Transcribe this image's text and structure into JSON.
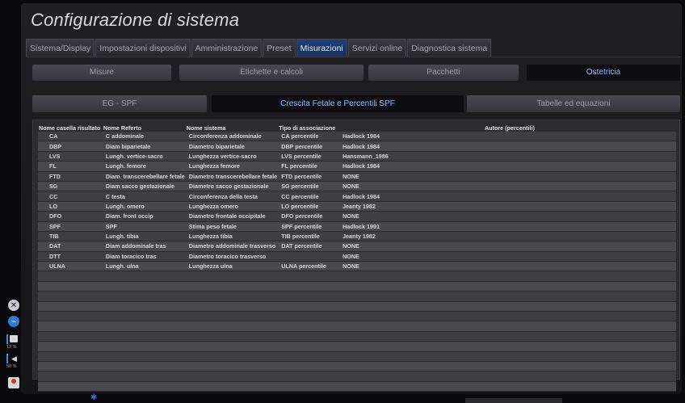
{
  "title": "Configurazione di sistema",
  "tabs": [
    {
      "label": "Sistema/Display",
      "active": false
    },
    {
      "label": "Impostazioni dispositivi",
      "active": false
    },
    {
      "label": "Amministrazione",
      "active": false
    },
    {
      "label": "Preset",
      "active": false
    },
    {
      "label": "Misurazioni",
      "active": true
    },
    {
      "label": "Servizi online",
      "active": false
    },
    {
      "label": "Diagnostica sistema",
      "active": false
    }
  ],
  "subtabs": [
    {
      "label": "Misure",
      "active": false
    },
    {
      "label": "Etichette e calcoli",
      "active": false
    },
    {
      "label": "Pacchetti",
      "active": false
    },
    {
      "label": "Ostetricia",
      "active": true
    }
  ],
  "subtabs2": [
    {
      "label": "EG - SPF",
      "active": false
    },
    {
      "label": "Crescita Fetale e Percentili SPF",
      "active": true
    },
    {
      "label": "Tabelle ed equazioni",
      "active": false
    }
  ],
  "table": {
    "headers": [
      "Nome casella risultato",
      "Nome Referto",
      "Nome sistema",
      "Tipo di associazione",
      "",
      "Autore (percentili)"
    ],
    "rows": [
      [
        "CA",
        "C addominale",
        "Circonferenza addominale",
        "CA percentile",
        "Hadlock 1984",
        ""
      ],
      [
        "DBP",
        "Diam biparietale",
        "Diametro biparietale",
        "DBP percentile",
        "Hadlock 1984",
        ""
      ],
      [
        "LVS",
        "Lungh. vertice-sacro",
        "Lunghezza vertice-sacro",
        "LVS percentile",
        "Hansmann_1986",
        ""
      ],
      [
        "FL",
        "Lungh. femore",
        "Lunghezza femore",
        "FL percentile",
        "Hadlock 1984",
        ""
      ],
      [
        "FTD",
        "Diam. transcerebellare fetale",
        "Diametro transcerebellare fetale",
        "FTD percentile",
        "NONE",
        ""
      ],
      [
        "SG",
        "Diam sacco gestazionale",
        "Diametro sacco gestazionale",
        "SG percentile",
        "NONE",
        ""
      ],
      [
        "CC",
        "C testa",
        "Circonferenza della testa",
        "CC percentile",
        "Hadlock 1984",
        ""
      ],
      [
        "LO",
        "Lungh. omero",
        "Lunghezza omero",
        "LO percentile",
        "Jeanty 1982",
        ""
      ],
      [
        "DFO",
        "Diam. front occip",
        "Diametro frontale occipitale",
        "DFO percentile",
        "NONE",
        ""
      ],
      [
        "SPF",
        "SPF",
        "Stima peso fetale",
        "SPF percentile",
        "Hadlock 1991",
        ""
      ],
      [
        "TIB",
        "Lungh. tibia",
        "Lunghezza tibia",
        "TIB percentile",
        "Jeanty 1982",
        ""
      ],
      [
        "DAT",
        "Diam addominale tras",
        "Diametro addominale trasverso",
        "DAT percentile",
        "NONE",
        ""
      ],
      [
        "DTT",
        "Diam toracico tras",
        "Diametro toracico trasverso",
        "",
        "NONE",
        ""
      ],
      [
        "ULNA",
        "Lungh. ulna",
        "Lunghezza ulna",
        "ULNA percentile",
        "NONE",
        ""
      ]
    ]
  },
  "side": {
    "printer_pct": "12 %",
    "volume_pct": "50 %"
  }
}
